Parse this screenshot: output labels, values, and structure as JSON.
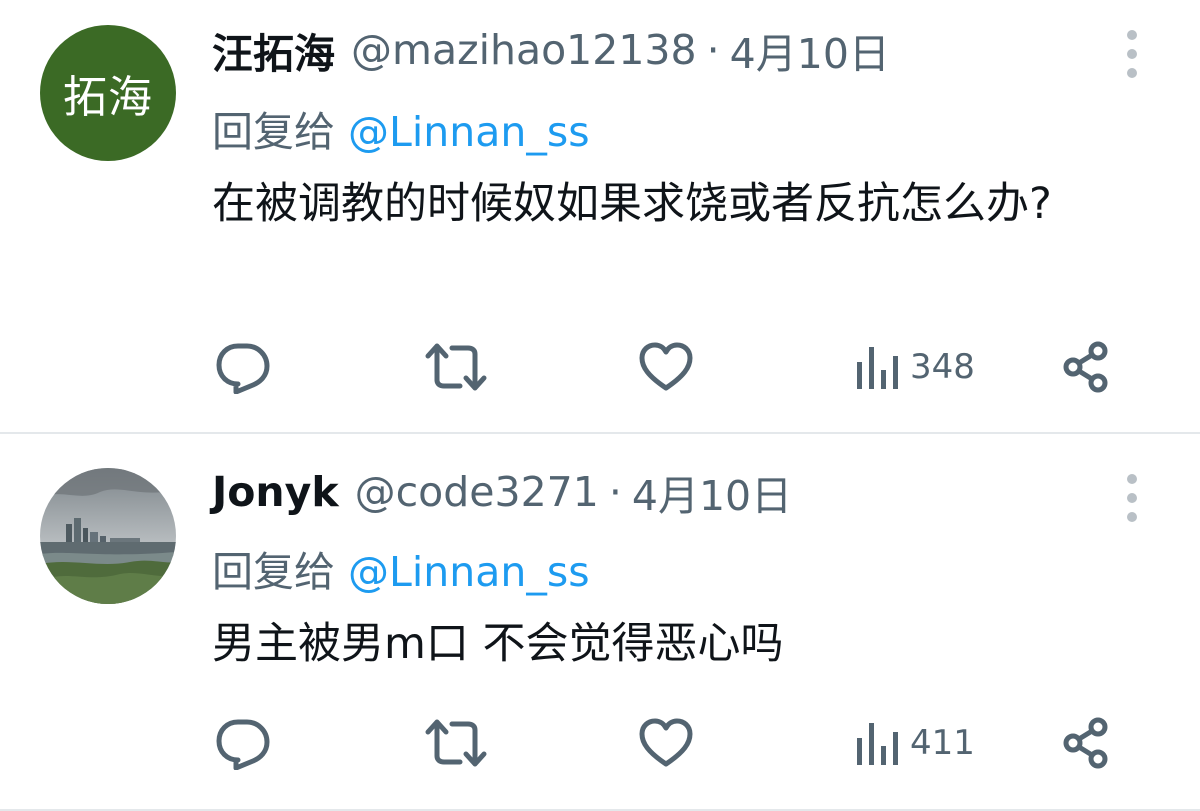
{
  "tweets": [
    {
      "avatar_label": "拓海",
      "display_name": "汪拓海",
      "handle": "@mazihao12138",
      "separator": "·",
      "date": "4月10日",
      "reply_prefix": "回复给",
      "reply_to": "@Linnan_ss",
      "text": "在被调教的时候奴如果求饶或者反抗怎么办?",
      "views": "348"
    },
    {
      "avatar_label": "",
      "display_name": "Jonyk",
      "handle": "@code3271",
      "separator": "·",
      "date": "4月10日",
      "reply_prefix": "回复给",
      "reply_to": "@Linnan_ss",
      "text": "男主被男m口 不会觉得恶心吗",
      "views": "411"
    }
  ],
  "icons": {
    "reply": "reply-icon",
    "retweet": "retweet-icon",
    "like": "heart-icon",
    "views": "bar-chart-icon",
    "share": "share-icon",
    "more": "more-vertical-icon"
  },
  "colors": {
    "text": "#0f1419",
    "secondary": "#536471",
    "link": "#1d9bf0",
    "avatar_green": "#3b6a25",
    "divider": "#e4e8eb"
  }
}
